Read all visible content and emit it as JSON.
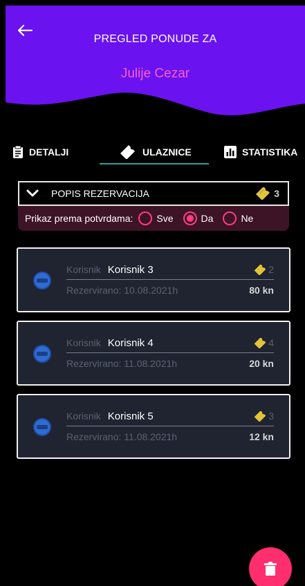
{
  "header": {
    "title": "PREGLED PONUDE ZA",
    "name": "Julije Cezar"
  },
  "tabs": [
    {
      "label": "DETALJI",
      "active": false
    },
    {
      "label": "ULAZNICE",
      "active": true
    },
    {
      "label": "STATISTIKA",
      "active": false
    }
  ],
  "reservations": {
    "title": "POPIS REZERVACIJA",
    "count": "3"
  },
  "filter": {
    "label": "Prikaz prema potvrdama:",
    "options": [
      {
        "label": "Sve",
        "selected": false
      },
      {
        "label": "Da",
        "selected": true
      },
      {
        "label": "Ne",
        "selected": false
      }
    ]
  },
  "cards": [
    {
      "user_label": "Korisnik",
      "user": "Korisnik 3",
      "reserved_label": "Rezervirano:",
      "date": "10.08.2021h",
      "tickets": "2",
      "price": "80 kn"
    },
    {
      "user_label": "Korisnik",
      "user": "Korisnik 4",
      "reserved_label": "Rezervirano:",
      "date": "11.08.2021h",
      "tickets": "4",
      "price": "20 kn"
    },
    {
      "user_label": "Korisnik",
      "user": "Korisnik 5",
      "reserved_label": "Rezervirano:",
      "date": "11.08.2021h",
      "tickets": "3",
      "price": "12 kn"
    }
  ],
  "colors": {
    "header": "#6a12f0",
    "accent": "#ff2e6e",
    "name": "#ff5ec8",
    "tab_indicator": "#1fa99a",
    "ticket": "#e0c43a"
  },
  "icons": {
    "back": "arrow-left",
    "details": "clipboard",
    "tickets": "ticket",
    "statistics": "bar-chart",
    "expand": "chevron-down",
    "delete": "trash"
  }
}
